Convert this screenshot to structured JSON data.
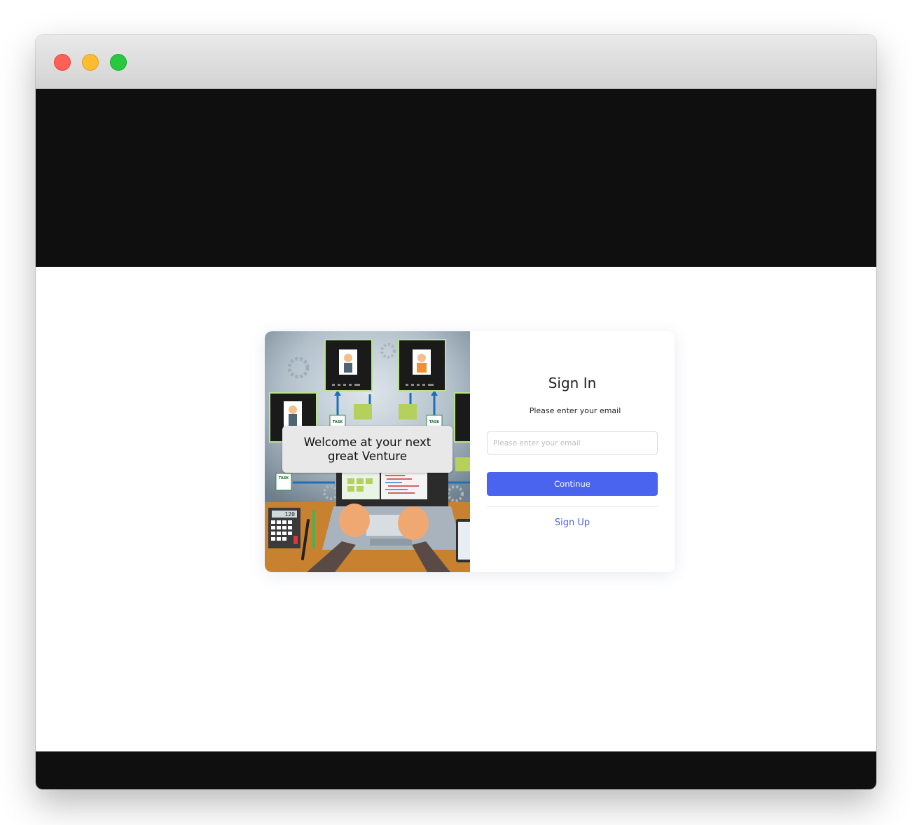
{
  "colors": {
    "accent": "#4a64f0",
    "dark_band": "#0f0f0f",
    "window_close": "#fe5f57",
    "window_minimize": "#febc2e",
    "window_maximize": "#28c840"
  },
  "window": {
    "controls": [
      "close-icon",
      "minimize-icon",
      "maximize-icon"
    ]
  },
  "illustration": {
    "icon": "remote-work-illustration",
    "welcome_text": "Welcome at your next great Venture",
    "calculator_display": "120",
    "task_label": "TASK"
  },
  "signin": {
    "title": "Sign In",
    "subtitle": "Please enter your email",
    "email_value": "",
    "email_placeholder": "Please enter your email",
    "continue_label": "Continue",
    "signup_label": "Sign Up"
  }
}
